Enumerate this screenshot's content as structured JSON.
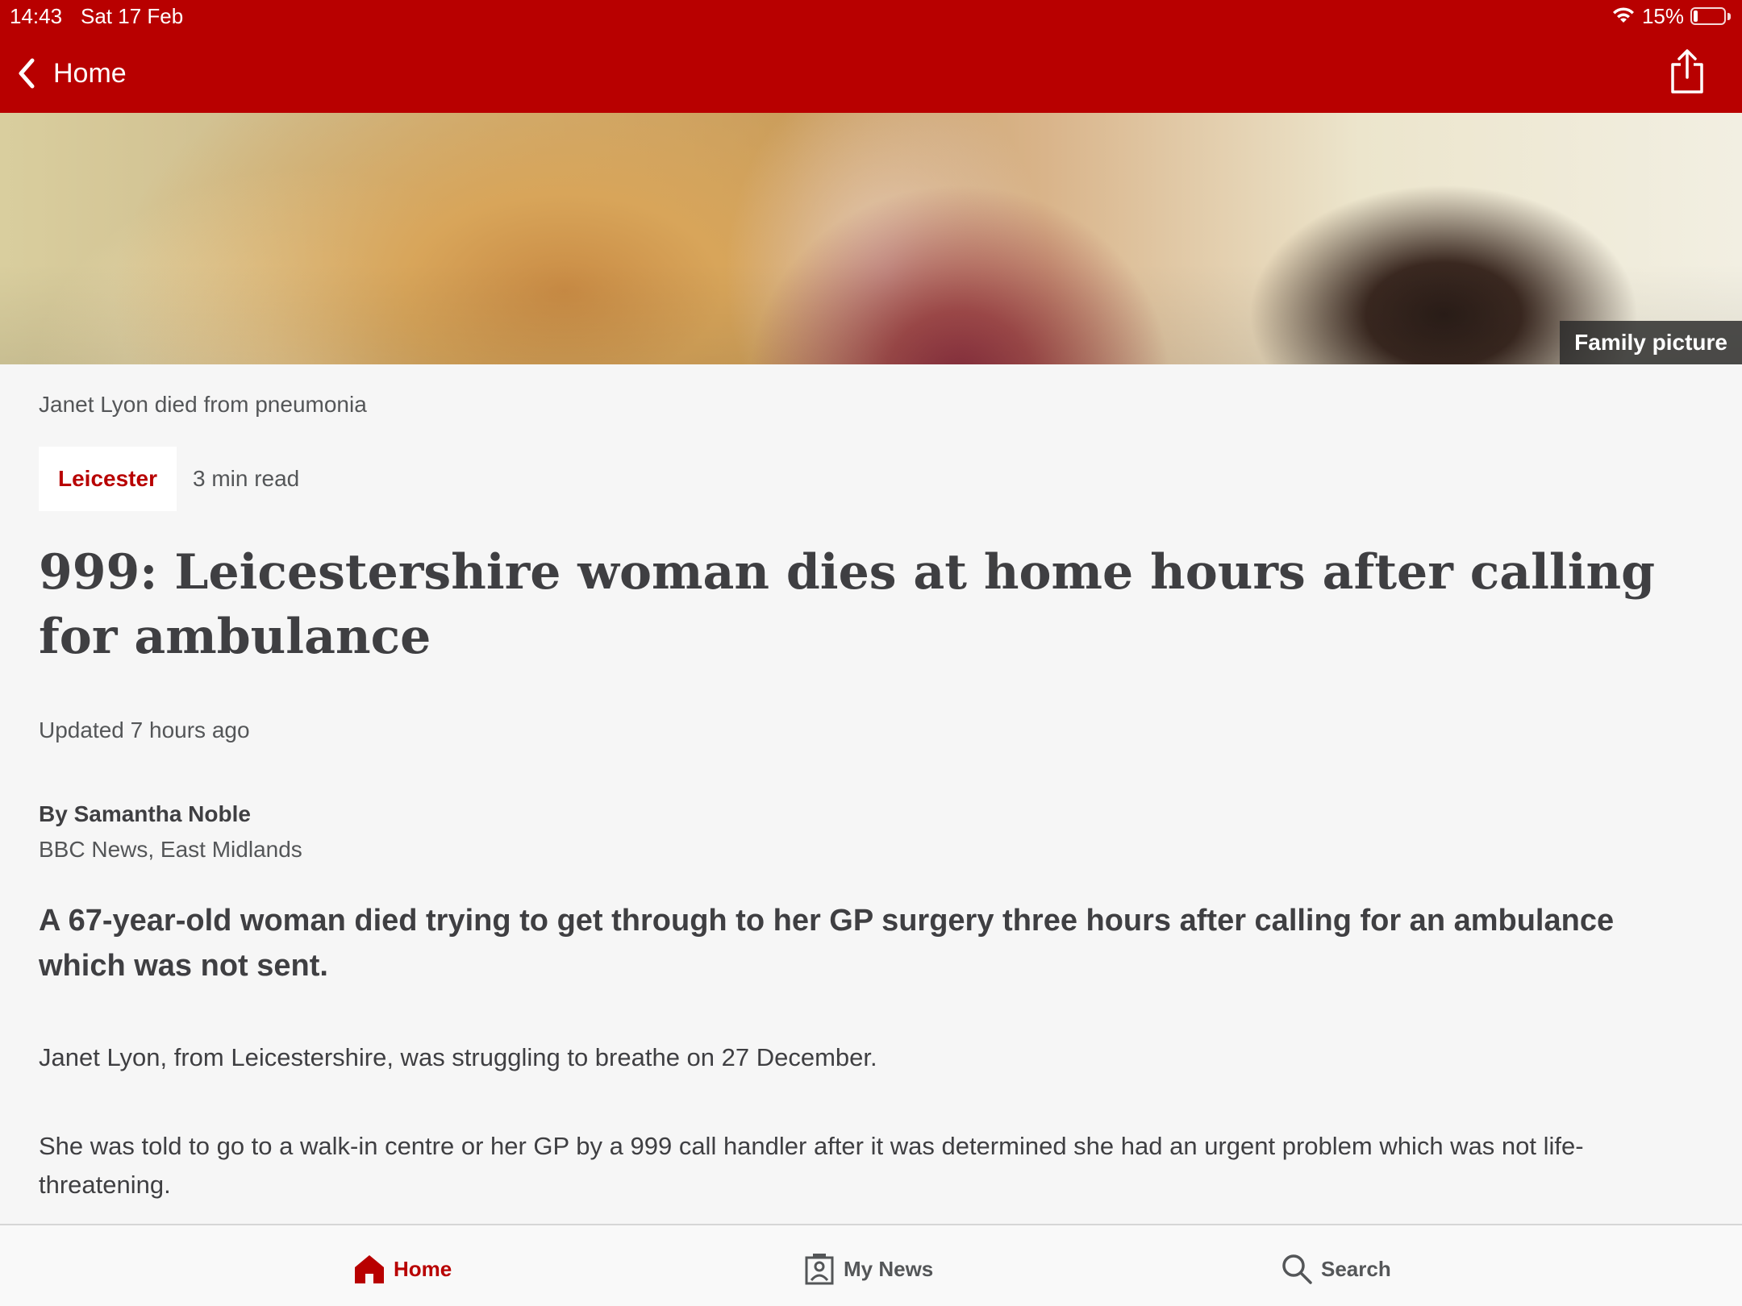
{
  "status_bar": {
    "time": "14:43",
    "date": "Sat 17 Feb",
    "battery_text": "15%",
    "battery_level": 0.15,
    "wifi_icon": "wifi-icon",
    "battery_icon": "battery-icon"
  },
  "nav": {
    "back_label": "Home",
    "back_icon": "chevron-left-icon",
    "share_icon": "share-icon"
  },
  "hero": {
    "credit": "Family picture"
  },
  "article": {
    "image_caption": "Janet Lyon died from pneumonia",
    "topic": "Leicester",
    "read_time": "3 min read",
    "headline": "999: Leicestershire woman dies at home hours after calling for ambulance",
    "updated": "Updated 7 hours ago",
    "byline_name": "By Samantha Noble",
    "byline_org": "BBC News, East Midlands",
    "summary": "A 67-year-old woman died trying to get through to her GP surgery three hours after calling for an ambulance which was not sent.",
    "paragraphs": [
      "Janet Lyon, from Leicestershire, was struggling to breathe on 27 December.",
      "She was told to go to a walk-in centre or her GP by a 999 call handler after it was determined she had an urgent problem which was not life-threatening."
    ]
  },
  "tabbar": {
    "tabs": [
      {
        "label": "Home",
        "icon": "home-icon",
        "active": true
      },
      {
        "label": "My News",
        "icon": "my-news-icon",
        "active": false
      },
      {
        "label": "Search",
        "icon": "search-icon",
        "active": false
      }
    ]
  },
  "colors": {
    "brand_red": "#b80000",
    "background": "#f6f6f6",
    "text": "#3f3f42",
    "muted_text": "#545658"
  }
}
